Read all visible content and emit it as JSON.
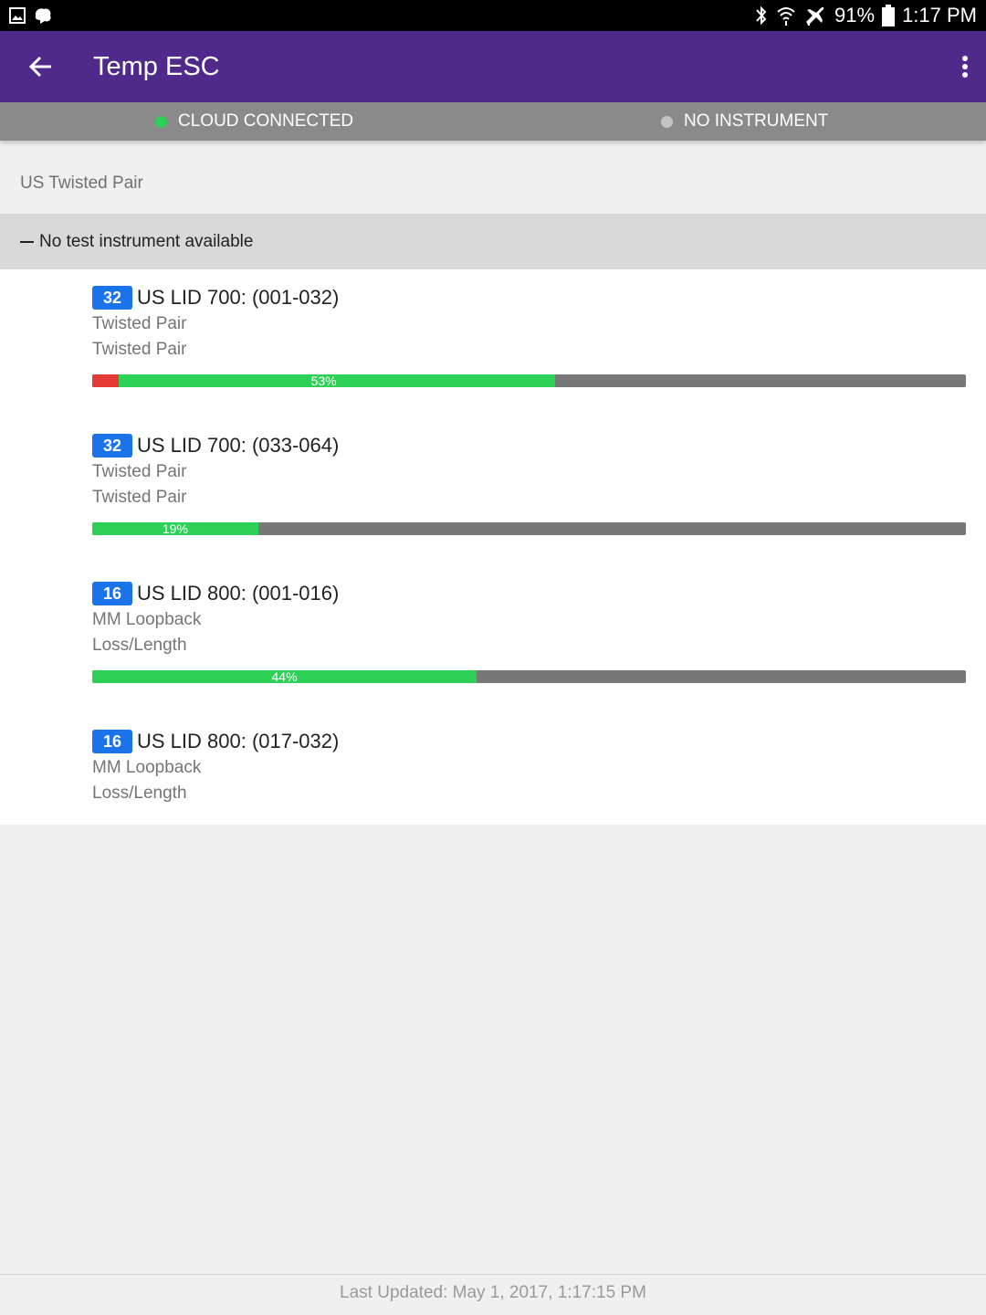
{
  "status_bar": {
    "left_icons": [
      "gallery-icon",
      "notification-app-icon"
    ],
    "right_icons": [
      "bluetooth-icon",
      "wifi-icon",
      "airplane-mode-icon"
    ],
    "battery": "91%",
    "time": "1:17 PM"
  },
  "app_bar": {
    "title": "Temp ESC",
    "background": "#4f2a8a"
  },
  "connection": {
    "cloud_label": "CLOUD CONNECTED",
    "cloud_color": "#2ed158",
    "instrument_label": "NO INSTRUMENT",
    "instrument_color": "#c4c4c4"
  },
  "section_label": "US Twisted Pair",
  "group_header": "No test instrument available",
  "items": [
    {
      "count": "32",
      "title": "US LID 700: (001-032)",
      "line1": "Twisted Pair",
      "line2": "Twisted Pair",
      "progress": {
        "fail_fraction": 0.03,
        "pass_fraction": 0.53,
        "label": "53%"
      }
    },
    {
      "count": "32",
      "title": "US LID 700: (033-064)",
      "line1": "Twisted Pair",
      "line2": "Twisted Pair",
      "progress": {
        "fail_fraction": 0,
        "pass_fraction": 0.19,
        "label": "19%"
      }
    },
    {
      "count": "16",
      "title": "US LID 800: (001-016)",
      "line1": "MM Loopback",
      "line2": "Loss/Length",
      "progress": {
        "fail_fraction": 0,
        "pass_fraction": 0.44,
        "label": "44%"
      }
    },
    {
      "count": "16",
      "title": "US LID 800: (017-032)",
      "line1": "MM Loopback",
      "line2": "Loss/Length"
    }
  ],
  "footer": "Last Updated: May 1, 2017, 1:17:15 PM"
}
